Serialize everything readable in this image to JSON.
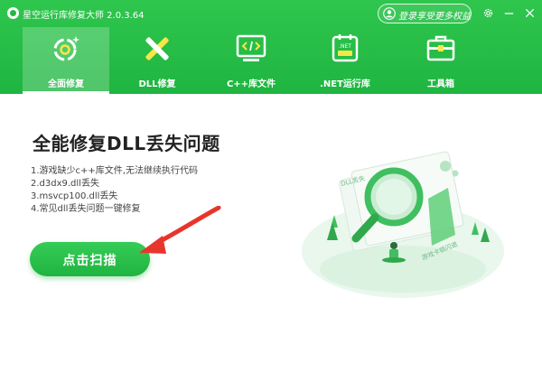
{
  "app": {
    "title": "星空运行库修复大师 2.0.3.64",
    "login_text": "登录享受更多权益",
    "icons": {
      "logo": "app-logo",
      "user": "user-icon",
      "settings": "gear-icon",
      "minimize": "minimize-icon",
      "close": "close-icon"
    }
  },
  "nav": {
    "tabs": [
      {
        "label": "全面修复",
        "icon": "refresh-repair-icon",
        "active": true
      },
      {
        "label": "DLL修复",
        "icon": "dll-tools-icon",
        "active": false
      },
      {
        "label": "C++库文件",
        "icon": "code-monitor-icon",
        "active": false
      },
      {
        "label": ".NET运行库",
        "icon": "dotnet-icon",
        "active": false
      },
      {
        "label": "工具箱",
        "icon": "toolbox-icon",
        "active": false
      }
    ]
  },
  "main": {
    "headline": "全能修复DLL丢失问题",
    "issues": [
      "1.游戏缺少c++库文件,无法继续执行代码",
      "2.d3dx9.dll丢失",
      "3.msvcp100.dll丢失",
      "4.常见dll丢失问题一键修复"
    ],
    "scan_button": "点击扫描",
    "illustration": {
      "label_dll": "DLL丢失",
      "label_game": "游戏卡顿闪退"
    }
  },
  "colors": {
    "brand_green": "#22b845",
    "header_top": "#2fc64e",
    "arrow_red": "#e8352b",
    "text_dark": "#222222"
  }
}
